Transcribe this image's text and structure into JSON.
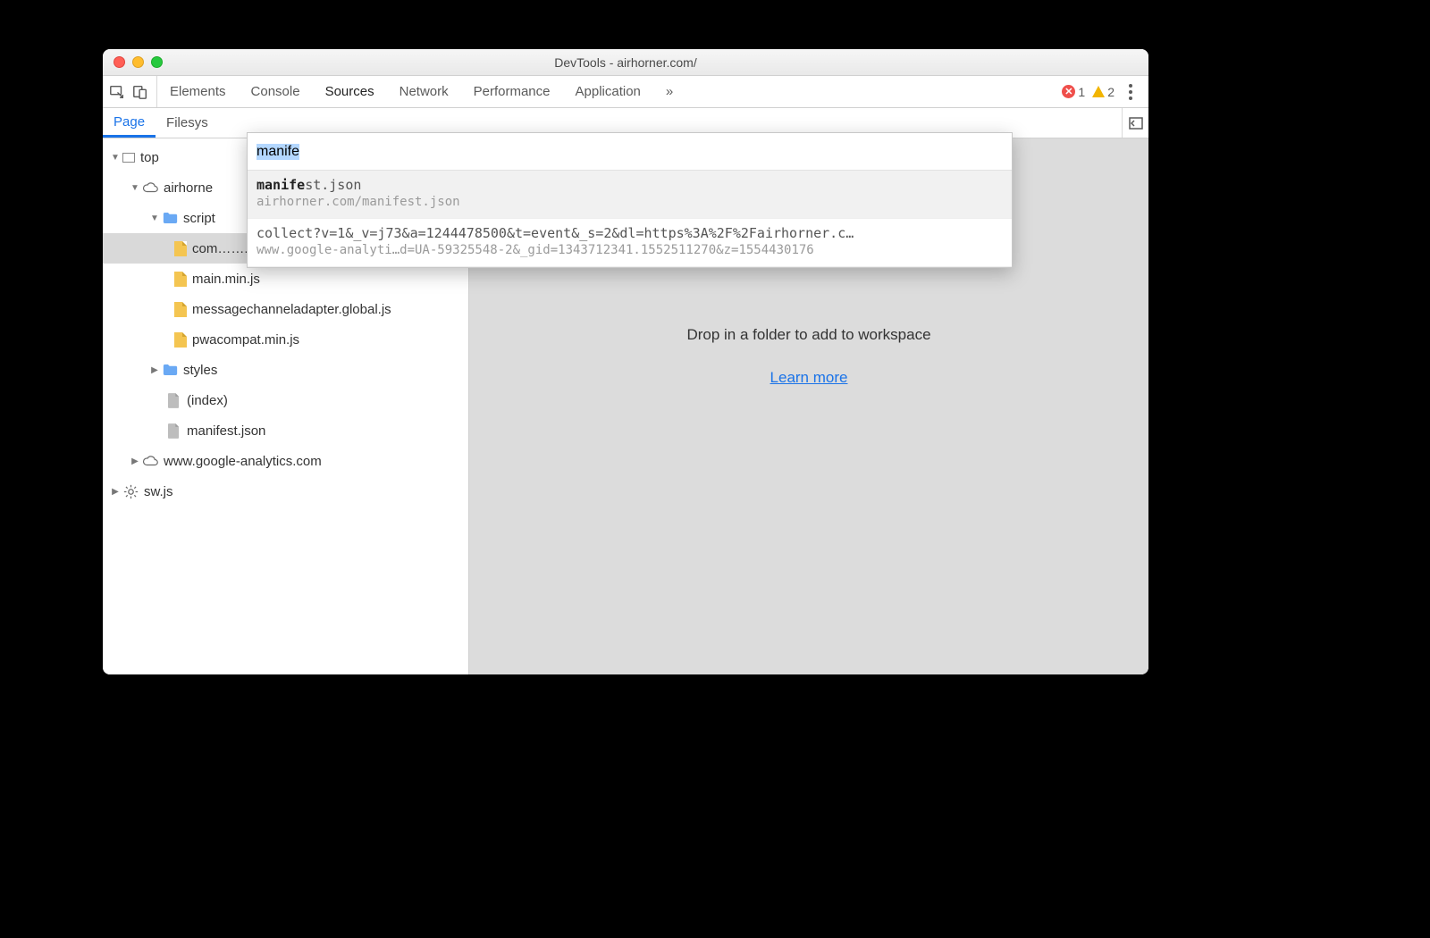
{
  "window": {
    "title": "DevTools - airhorner.com/"
  },
  "toolbar": {
    "tabs": [
      "Elements",
      "Console",
      "Sources",
      "Network",
      "Performance",
      "Application"
    ],
    "active_tab": "Sources",
    "overflow_glyph": "»",
    "errors_count": "1",
    "warnings_count": "2"
  },
  "page_tabs": {
    "items": [
      "Page",
      "Filesys"
    ],
    "selected": "Page"
  },
  "tree": {
    "top": "top",
    "domain1": "airhorne",
    "scripts_folder": "script",
    "scripts_files": [
      "com…….global.js",
      "main.min.js",
      "messagechanneladapter.global.js",
      "pwacompat.min.js"
    ],
    "styles_folder": "styles",
    "index_file": "(index)",
    "manifest_file": "manifest.json",
    "domain2": "www.google-analytics.com",
    "sw_file": "sw.js"
  },
  "workspace": {
    "drop_text": "Drop in a folder to add to workspace",
    "learn_more": "Learn more"
  },
  "palette": {
    "query": "manife",
    "results": [
      {
        "bold": "manife",
        "rest": "st.json",
        "sub": "airhorner.com/manifest.json"
      },
      {
        "title_full": "collect?v=1&_v=j73&a=1244478500&t=event&_s=2&dl=https%3A%2F%2Fairhorner.c…",
        "sub": "www.google-analyti…d=UA-59325548-2&_gid=1343712341.1552511270&z=1554430176"
      }
    ]
  }
}
